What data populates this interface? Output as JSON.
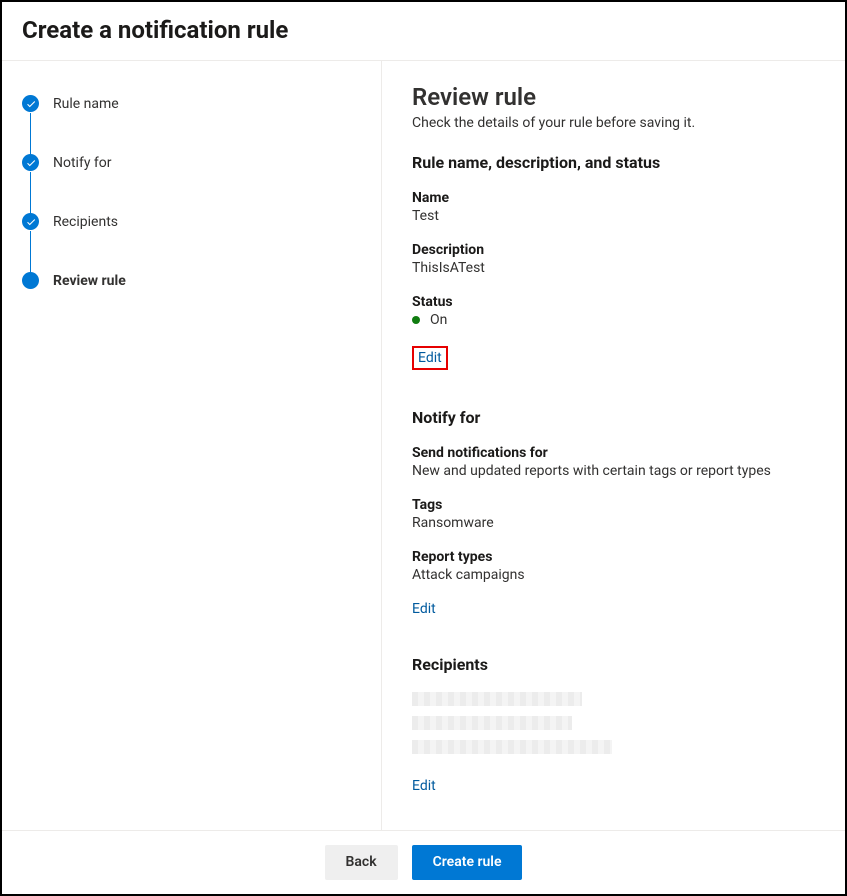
{
  "header": {
    "title": "Create a notification rule"
  },
  "stepper": {
    "items": [
      {
        "label": "Rule name",
        "state": "done"
      },
      {
        "label": "Notify for",
        "state": "done"
      },
      {
        "label": "Recipients",
        "state": "done"
      },
      {
        "label": "Review rule",
        "state": "current"
      }
    ]
  },
  "review": {
    "heading": "Review rule",
    "subtitle": "Check the details of your rule before saving it.",
    "section1": {
      "heading": "Rule name, description, and status",
      "name_label": "Name",
      "name_value": "Test",
      "description_label": "Description",
      "description_value": "ThisIsATest",
      "status_label": "Status",
      "status_value": "On",
      "status_color": "#107c10",
      "edit_label": "Edit"
    },
    "section2": {
      "heading": "Notify for",
      "send_label": "Send notifications for",
      "send_value": "New and updated reports with certain tags or report types",
      "tags_label": "Tags",
      "tags_value": "Ransomware",
      "types_label": "Report types",
      "types_value": "Attack campaigns",
      "edit_label": "Edit"
    },
    "section3": {
      "heading": "Recipients",
      "edit_label": "Edit"
    }
  },
  "footer": {
    "back_label": "Back",
    "create_label": "Create rule"
  }
}
